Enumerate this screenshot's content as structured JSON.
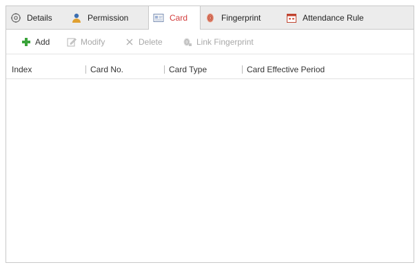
{
  "tabs": [
    {
      "label": "Details",
      "icon": "details-icon",
      "active": false
    },
    {
      "label": "Permission",
      "icon": "permission-icon",
      "active": false
    },
    {
      "label": "Card",
      "icon": "card-icon",
      "active": true
    },
    {
      "label": "Fingerprint",
      "icon": "fingerprint-icon",
      "active": false
    },
    {
      "label": "Attendance Rule",
      "icon": "attendance-rule-icon",
      "active": false
    }
  ],
  "toolbar": {
    "add_label": "Add",
    "modify_label": "Modify",
    "delete_label": "Delete",
    "link_fingerprint_label": "Link Fingerprint"
  },
  "table": {
    "columns": [
      "Index",
      "Card No.",
      "Card Type",
      "Card Effective Period"
    ],
    "rows": []
  },
  "colors": {
    "active_tab_text": "#d23a3a",
    "add_icon": "#3aa33a",
    "disabled_text": "#a8a8a8"
  }
}
